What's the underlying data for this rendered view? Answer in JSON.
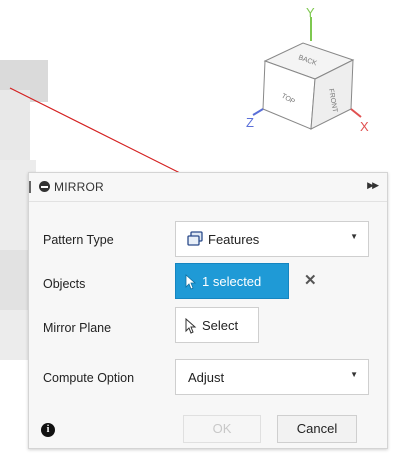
{
  "viewcube": {
    "axis_y": "Y",
    "axis_z": "Z",
    "axis_x": "X",
    "face_top": "TOP",
    "face_front": "FRONT",
    "face_back": "BACK",
    "axis_colors": {
      "y": "#7ec850",
      "z": "#5a6fd8",
      "x": "#e05050"
    }
  },
  "dialog": {
    "title": "MIRROR",
    "rows": {
      "pattern_type": {
        "label": "Pattern Type",
        "value": "Features",
        "icon": "features-icon"
      },
      "objects": {
        "label": "Objects",
        "value": "1 selected",
        "icon": "cursor-arrow-icon"
      },
      "mirror_plane": {
        "label": "Mirror Plane",
        "value": "Select",
        "icon": "cursor-arrow-outline-icon"
      },
      "compute_option": {
        "label": "Compute Option",
        "value": "Adjust"
      }
    },
    "buttons": {
      "ok": "OK",
      "cancel": "Cancel"
    },
    "accent": "#1f9ad6"
  },
  "annotation": {
    "arrow_color": "#d42020"
  }
}
